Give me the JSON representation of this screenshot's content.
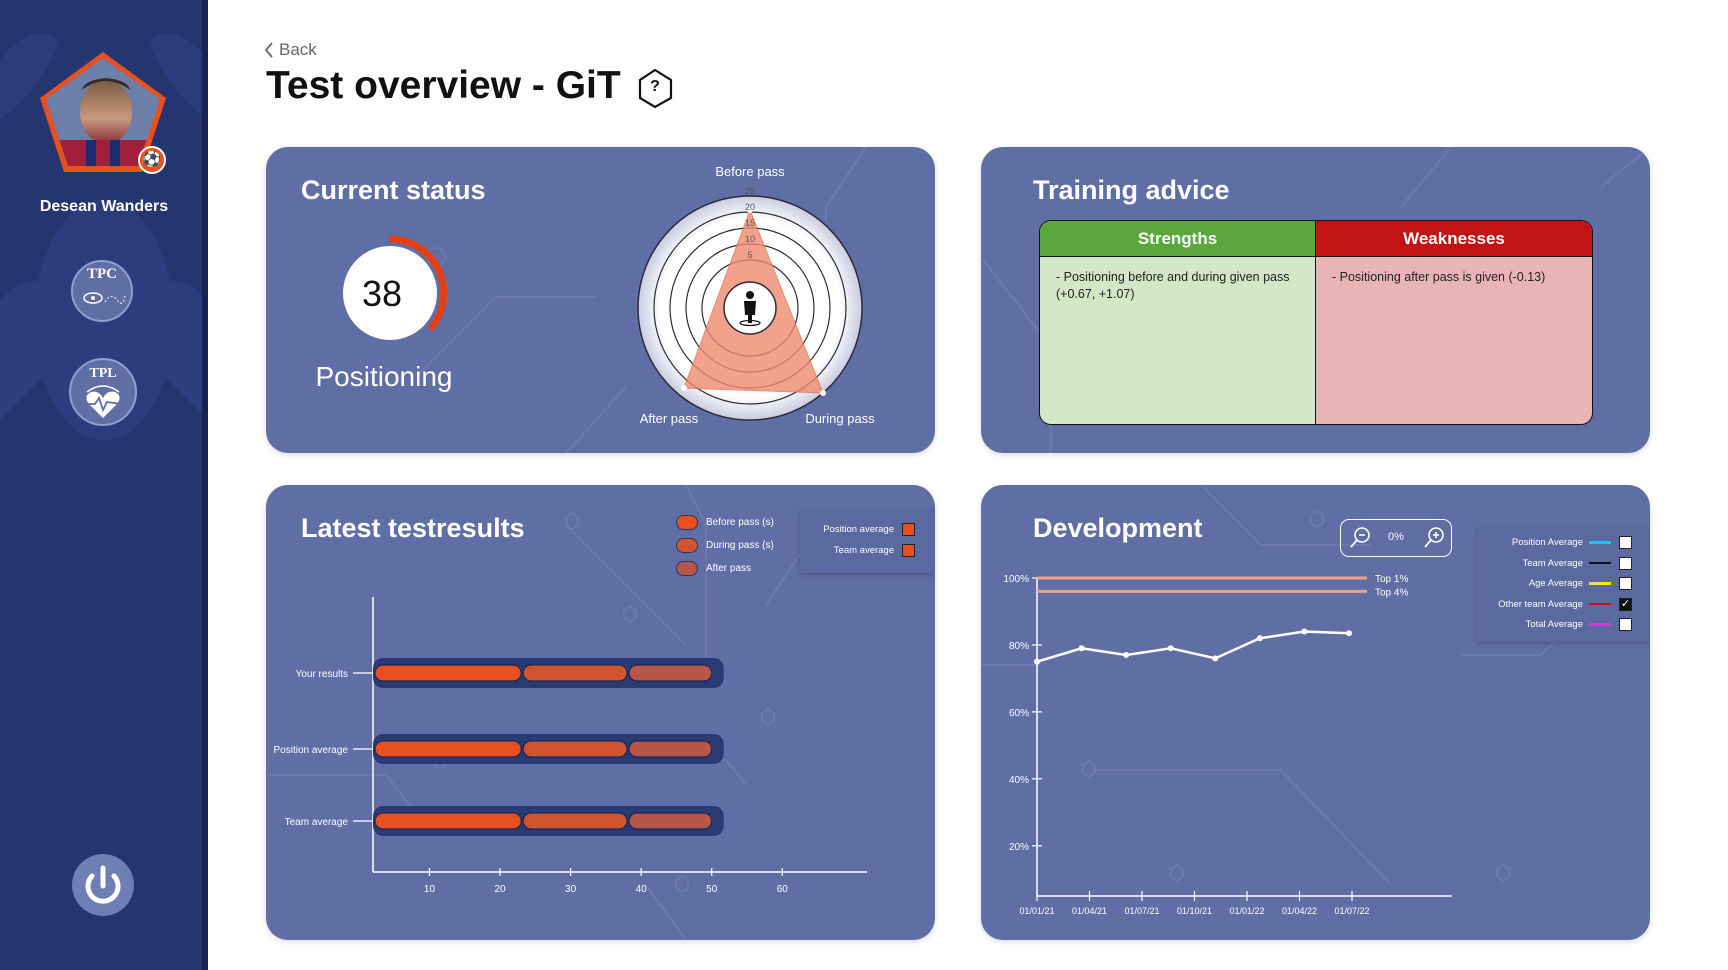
{
  "sidebar": {
    "user_name": "Desean Wanders",
    "apps": [
      {
        "label": "TPC"
      },
      {
        "label": "TPL"
      }
    ]
  },
  "header": {
    "back_label": "Back",
    "title": "Test overview - GiT",
    "help_label": "?"
  },
  "current_status": {
    "title": "Current status",
    "score": "38",
    "score_label": "Positioning",
    "radar": {
      "axes": [
        "Before pass",
        "During pass",
        "After pass"
      ],
      "ticks": [
        "25",
        "20",
        "15",
        "10",
        "5"
      ]
    }
  },
  "training_advice": {
    "title": "Training advice",
    "strengths_label": "Strengths",
    "weaknesses_label": "Weaknesses",
    "strengths_text": "- Positioning before and during given pass (+0.67, +1.07)",
    "weaknesses_text": "- Positioning after pass is given (-0.13)"
  },
  "latest": {
    "title": "Latest testresults",
    "legend": [
      "Before pass (s)",
      "During pass (s)",
      "After pass"
    ],
    "toggles": [
      "Position average",
      "Team average"
    ],
    "chart_data": {
      "type": "bar",
      "orientation": "horizontal",
      "stacked": true,
      "categories": [
        "Your results",
        "Position average",
        "Team average"
      ],
      "series": [
        {
          "name": "Before pass (s)",
          "values": [
            21,
            21,
            21
          ]
        },
        {
          "name": "During pass (s)",
          "values": [
            15,
            15,
            15
          ]
        },
        {
          "name": "After pass",
          "values": [
            12,
            12,
            12
          ]
        }
      ],
      "xticks": [
        "10",
        "20",
        "30",
        "40",
        "50",
        "60"
      ],
      "xlim": [
        2,
        72
      ]
    }
  },
  "development": {
    "title": "Development",
    "zoom": "0%",
    "refs": [
      {
        "label": "Top 1%",
        "value": 100
      },
      {
        "label": "Top 4%",
        "value": 96
      }
    ],
    "toggles": [
      {
        "label": "Position Average",
        "color": "#21c4e8",
        "checked": false
      },
      {
        "label": "Team Average",
        "color": "#111111",
        "checked": false
      },
      {
        "label": "Age Average",
        "color": "#f2e230",
        "checked": false
      },
      {
        "label": "Other team Average",
        "color": "#d0102a",
        "checked": true
      },
      {
        "label": "Total Average",
        "color": "#d23ad8",
        "checked": false
      }
    ],
    "chart_data": {
      "type": "line",
      "x": [
        "01/01/21",
        "01/04/21",
        "01/07/21",
        "01/10/21",
        "01/01/22",
        "01/04/22",
        "01/07/22"
      ],
      "yticks": [
        "100%",
        "80%",
        "60%",
        "40%",
        "20%"
      ],
      "ylim": [
        5,
        100
      ],
      "series": [
        {
          "values": [
            75,
            79,
            77,
            79,
            76,
            82,
            84,
            83.5
          ]
        }
      ]
    }
  },
  "colors": {
    "sidebar": "#25356f",
    "card": "#5f6fa6",
    "bar1": "#e8501f",
    "bar2": "#d0552e",
    "bar3": "#b7574a",
    "strength": "#5aa83d",
    "weakness": "#c21414"
  }
}
